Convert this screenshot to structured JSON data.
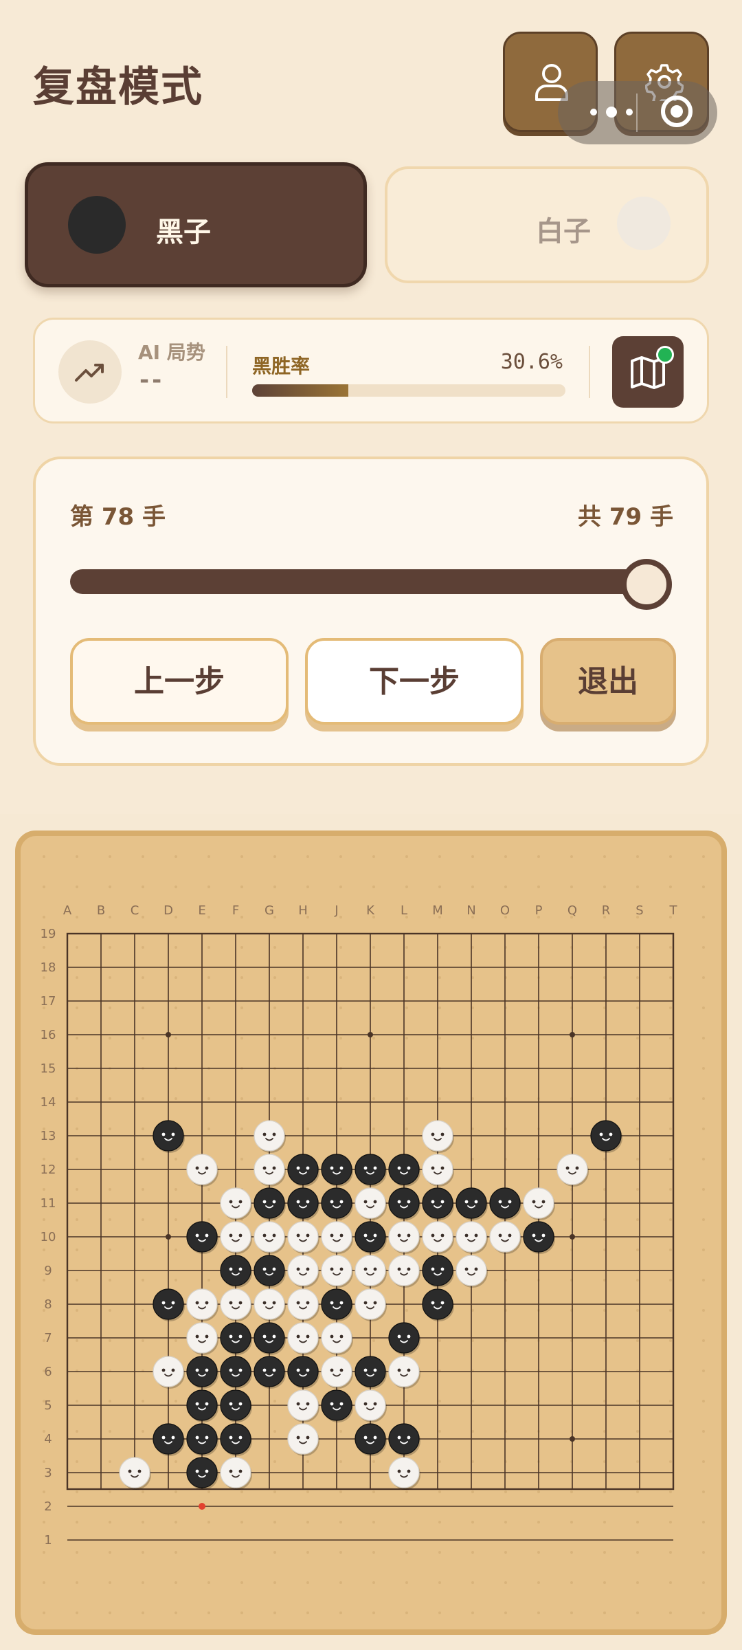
{
  "header": {
    "title": "复盘模式",
    "user_icon": "user-icon",
    "settings_icon": "gear-icon"
  },
  "capsule": {
    "more_icon": "more-dots-icon",
    "close_icon": "record-circle-icon"
  },
  "players": {
    "black": {
      "label": "黑子",
      "color": "#2a2a2a",
      "active": true
    },
    "white": {
      "label": "白子",
      "color": "#f0e9df",
      "active": false
    }
  },
  "ai": {
    "label": "AI 局势",
    "value": "--",
    "winrate_label": "黑胜率",
    "winrate_text": "30.6%",
    "winrate": 0.306,
    "map_icon": "map-icon",
    "status_color": "#22b354"
  },
  "replay": {
    "current_label": "第 78 手",
    "total_label": "共 79 手",
    "current": 78,
    "total": 79,
    "prev_label": "上一步",
    "next_label": "下一步",
    "exit_label": "退出"
  },
  "board": {
    "size": 19,
    "col_labels": [
      "A",
      "B",
      "C",
      "D",
      "E",
      "F",
      "G",
      "H",
      "J",
      "K",
      "L",
      "M",
      "N",
      "O",
      "P",
      "Q",
      "R",
      "S",
      "T"
    ],
    "row_labels": [
      "19",
      "18",
      "17",
      "16",
      "15",
      "14",
      "13",
      "12",
      "11",
      "10",
      "9",
      "8",
      "7",
      "6",
      "5",
      "4",
      "3",
      "2",
      "1"
    ],
    "colors": {
      "wood": "#e6c28a",
      "line": "#4a3426",
      "black_stone": "#2b2b2b",
      "white_stone": "#f5f2ee",
      "last_move": "#e2412f"
    },
    "last_move": "E2",
    "black": [
      "D13",
      "R13",
      "H12",
      "J12",
      "K12",
      "L12",
      "G11",
      "H11",
      "J11",
      "L11",
      "M11",
      "N11",
      "O11",
      "E10",
      "K10",
      "P10",
      "F9",
      "G9",
      "M9",
      "D8",
      "J8",
      "M8",
      "F7",
      "G7",
      "L7",
      "E6",
      "F6",
      "G6",
      "H6",
      "K6",
      "E5",
      "F5",
      "J5",
      "D4",
      "E4",
      "F4",
      "K4",
      "L4",
      "E3"
    ],
    "white": [
      "G13",
      "M13",
      "E12",
      "G12",
      "M12",
      "Q12",
      "F11",
      "K11",
      "P11",
      "F10",
      "G10",
      "H10",
      "J10",
      "L10",
      "M10",
      "N10",
      "O10",
      "H9",
      "J9",
      "K9",
      "L9",
      "N9",
      "E8",
      "F8",
      "G8",
      "H8",
      "K8",
      "E7",
      "H7",
      "J7",
      "D6",
      "J6",
      "L6",
      "H5",
      "K5",
      "H4",
      "C3",
      "F3",
      "L3"
    ]
  }
}
